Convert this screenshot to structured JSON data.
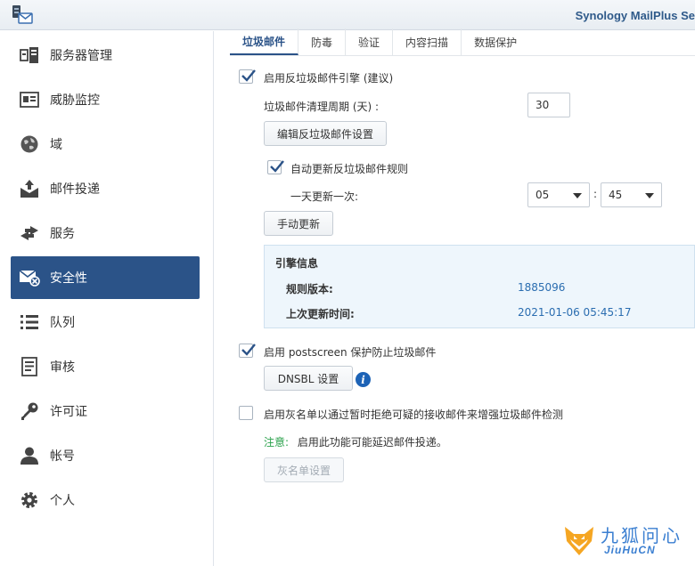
{
  "window": {
    "title": "Synology MailPlus Se"
  },
  "sidebar": {
    "items": [
      {
        "label": "服务器管理",
        "icon": "server-management-icon"
      },
      {
        "label": "威胁监控",
        "icon": "threat-monitor-icon"
      },
      {
        "label": "域",
        "icon": "globe-icon"
      },
      {
        "label": "邮件投递",
        "icon": "mail-delivery-icon"
      },
      {
        "label": "服务",
        "icon": "service-arrows-icon"
      },
      {
        "label": "安全性",
        "icon": "security-mail-icon",
        "active": true
      },
      {
        "label": "队列",
        "icon": "queue-list-icon"
      },
      {
        "label": "审核",
        "icon": "audit-icon"
      },
      {
        "label": "许可证",
        "icon": "license-key-icon"
      },
      {
        "label": "帐号",
        "icon": "account-user-icon"
      },
      {
        "label": "个人",
        "icon": "personal-gear-icon"
      }
    ]
  },
  "tabs": [
    {
      "label": "垃圾邮件",
      "active": true
    },
    {
      "label": "防毒"
    },
    {
      "label": "验证"
    },
    {
      "label": "内容扫描"
    },
    {
      "label": "数据保护"
    }
  ],
  "spam": {
    "enable_engine_label": "启用反垃圾邮件引擎 (建议)",
    "cleanup_period_label": "垃圾邮件清理周期 (天) :",
    "cleanup_period_value": "30",
    "edit_settings_button": "编辑反垃圾邮件设置",
    "auto_update_label": "自动更新反垃圾邮件规则",
    "daily_update_label": "一天更新一次:",
    "hour_value": "05",
    "time_separator": ":",
    "minute_value": "45",
    "manual_update_button": "手动更新",
    "engine_info": {
      "title": "引擎信息",
      "rule_version_label": "规则版本:",
      "rule_version_value": "1885096",
      "last_update_label": "上次更新时间:",
      "last_update_value": "2021-01-06 05:45:17"
    },
    "postscreen_label": "启用 postscreen 保护防止垃圾邮件",
    "dnsbl_button": "DNSBL 设置",
    "info_glyph": "i",
    "greylist_label": "启用灰名单以通过暂时拒绝可疑的接收邮件来增强垃圾邮件检测",
    "note_prefix": "注意:",
    "note_text": "启用此功能可能延迟邮件投递。",
    "greylist_button": "灰名单设置"
  },
  "watermark": {
    "title": "九狐问心",
    "subtitle": "JiuHuCN"
  },
  "colors": {
    "accent": "#2b5388",
    "info_blue": "#1d63b6",
    "note_green": "#2aa14b",
    "value_blue": "#2a6db0"
  }
}
